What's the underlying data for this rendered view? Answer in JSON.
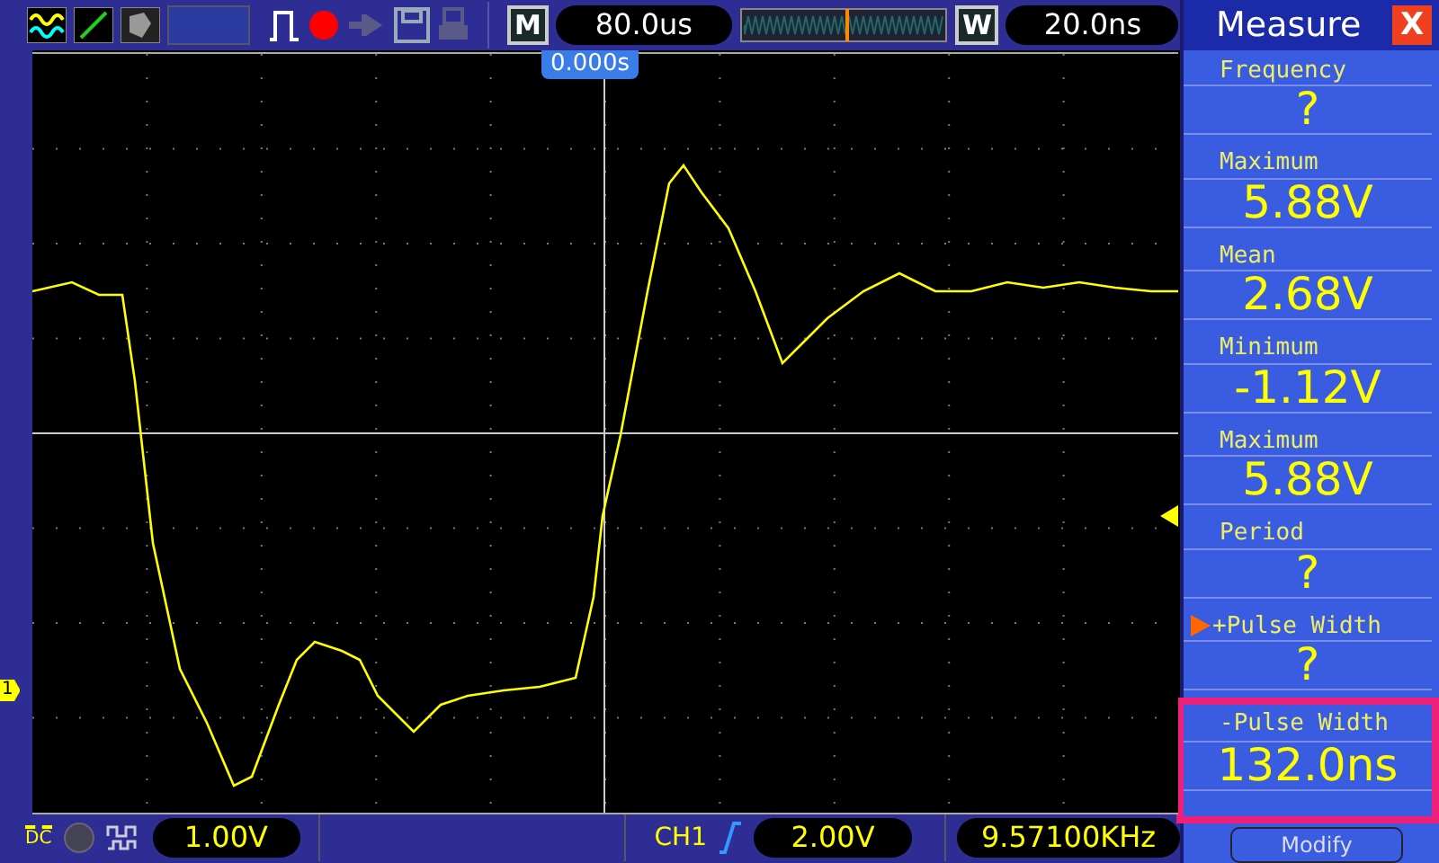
{
  "toolbar": {
    "mode_badge": "M",
    "timebase": "80.0us",
    "window_badge": "W",
    "window_time": "20.0ns",
    "recording": true
  },
  "screen": {
    "trigger_time": "0.000s",
    "channel_marker": "1"
  },
  "status_bar": {
    "coupling": "DC",
    "ch1_scale": "1.00V",
    "trigger_source": "CH1",
    "trigger_level": "2.00V",
    "frequency": "9.57100KHz"
  },
  "measure_panel": {
    "title": "Measure",
    "close": "X",
    "button": "Modify",
    "items": [
      {
        "label": "Frequency",
        "value": "?",
        "selected": false,
        "pointer": false
      },
      {
        "label": "Maximum",
        "value": "5.88V",
        "selected": false,
        "pointer": false
      },
      {
        "label": "Mean",
        "value": "2.68V",
        "selected": false,
        "pointer": false
      },
      {
        "label": "Minimum",
        "value": "-1.12V",
        "selected": false,
        "pointer": false
      },
      {
        "label": "Maximum",
        "value": "5.88V",
        "selected": false,
        "pointer": false
      },
      {
        "label": "Period",
        "value": "?",
        "selected": false,
        "pointer": false
      },
      {
        "label": "+Pulse Width",
        "value": "?",
        "selected": false,
        "pointer": true
      },
      {
        "label": "-Pulse Width",
        "value": "132.0ns",
        "selected": true,
        "pointer": false
      }
    ]
  }
}
